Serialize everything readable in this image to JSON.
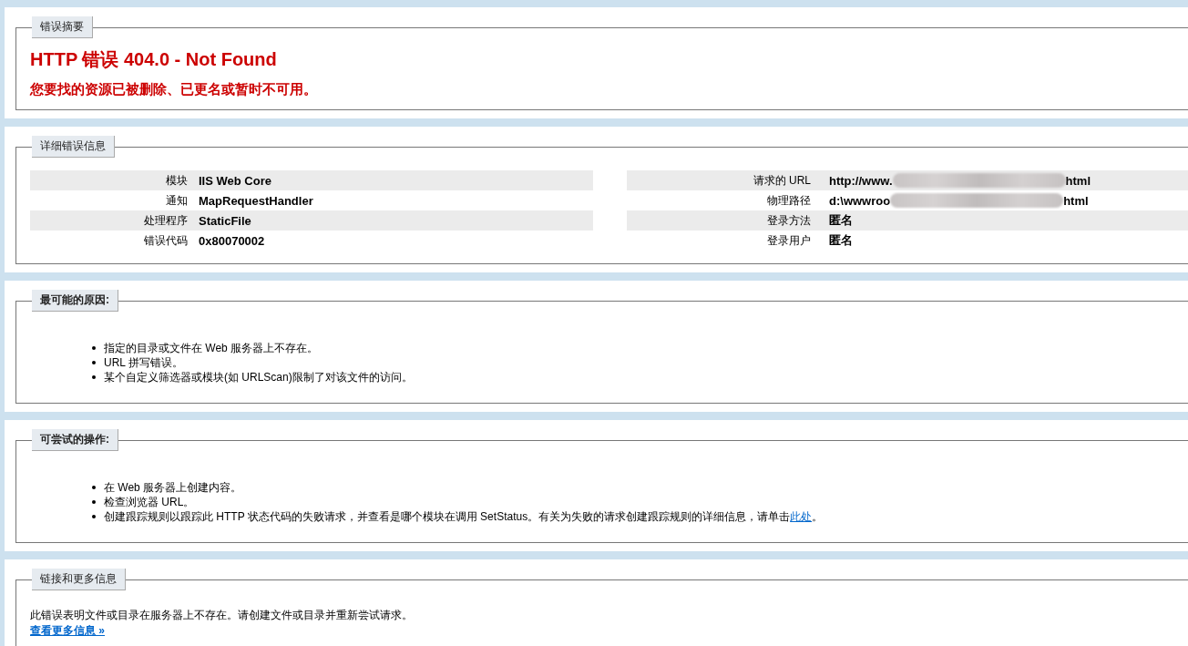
{
  "sections": [
    {
      "kind": "summary",
      "legend": "错误摘要",
      "heading": "HTTP 错误 404.0 - Not Found",
      "subheading": "您要找的资源已被删除、已更名或暂时不可用。"
    },
    {
      "kind": "details",
      "legend": "详细错误信息",
      "left_rows": [
        {
          "label": "模块",
          "value": "IIS Web Core"
        },
        {
          "label": "通知",
          "value": "MapRequestHandler"
        },
        {
          "label": "处理程序",
          "value": "StaticFile"
        },
        {
          "label": "错误代码",
          "value": "0x80070002"
        }
      ],
      "right_rows": [
        {
          "label": "请求的 URL",
          "value": "http://www.",
          "value_end": "html"
        },
        {
          "label": "物理路径",
          "value": "d:\\wwwroo",
          "value_end": "html"
        },
        {
          "label": "登录方法",
          "value": "匿名"
        },
        {
          "label": "登录用户",
          "value": "匿名"
        }
      ]
    },
    {
      "kind": "list",
      "legend": "最可能的原因:",
      "items": [
        {
          "text": "指定的目录或文件在 Web 服务器上不存在。"
        },
        {
          "text": "URL 拼写错误。"
        },
        {
          "text": "某个自定义筛选器或模块(如 URLScan)限制了对该文件的访问。"
        }
      ]
    },
    {
      "kind": "list",
      "legend": "可尝试的操作:",
      "items": [
        {
          "text": "在 Web 服务器上创建内容。"
        },
        {
          "text": "检查浏览器 URL。"
        },
        {
          "text": "创建跟踪规则以跟踪此 HTTP 状态代码的失败请求，并查看是哪个模块在调用 SetStatus。有关为失败的请求创建跟踪规则的详细信息，请单击",
          "link": "此处",
          "text_after": "。"
        }
      ]
    },
    {
      "kind": "info",
      "legend": "链接和更多信息",
      "text": "此错误表明文件或目录在服务器上不存在。请创建文件或目录并重新尝试请求。",
      "link": "查看更多信息 »"
    }
  ]
}
